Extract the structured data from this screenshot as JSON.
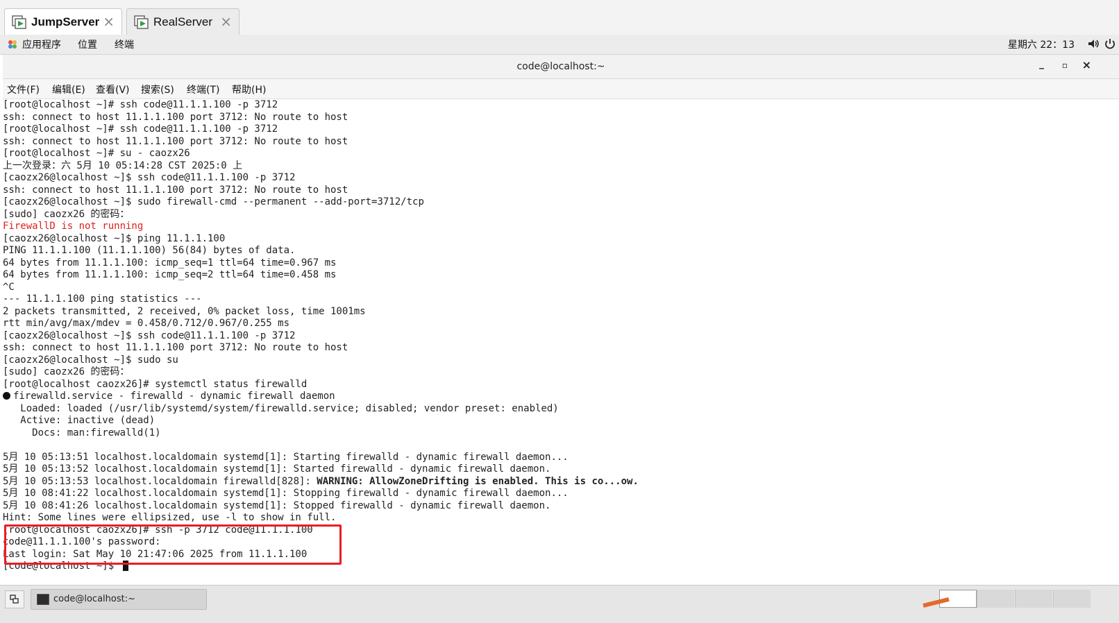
{
  "vm_tabs": [
    {
      "label": "JumpServer",
      "active": true,
      "icon": "vm-play-icon"
    },
    {
      "label": "RealServer",
      "active": false,
      "icon": "vm-play-icon"
    }
  ],
  "topbar": {
    "applications": "应用程序",
    "places": "位置",
    "terminal": "终端",
    "clock": "星期六 22：13",
    "volume_icon": "volume-icon",
    "power_icon": "power-icon"
  },
  "window": {
    "title": "code@localhost:~",
    "minimize": "_",
    "maximize": "▫",
    "close": "×"
  },
  "menubar": [
    "文件(F)",
    "编辑(E)",
    "查看(V)",
    "搜索(S)",
    "终端(T)",
    "帮助(H)"
  ],
  "terminal_lines": [
    "[root@localhost ~]# ssh code@11.1.1.100 -p 3712",
    "ssh: connect to host 11.1.1.100 port 3712: No route to host",
    "[root@localhost ~]# ssh code@11.1.1.100 -p 3712",
    "ssh: connect to host 11.1.1.100 port 3712: No route to host",
    "[root@localhost ~]# su - caozx26",
    "上一次登录：六 5月 10 05:14:28 CST 2025:0 上",
    "[caozx26@localhost ~]$ ssh code@11.1.1.100 -p 3712",
    "ssh: connect to host 11.1.1.100 port 3712: No route to host",
    "[caozx26@localhost ~]$ sudo firewall-cmd --permanent --add-port=3712/tcp",
    "[sudo] caozx26 的密码：",
    "FirewallD is not running",
    "[caozx26@localhost ~]$ ping 11.1.1.100",
    "PING 11.1.1.100 (11.1.1.100) 56(84) bytes of data.",
    "64 bytes from 11.1.1.100: icmp_seq=1 ttl=64 time=0.967 ms",
    "64 bytes from 11.1.1.100: icmp_seq=2 ttl=64 time=0.458 ms",
    "^C",
    "--- 11.1.1.100 ping statistics ---",
    "2 packets transmitted, 2 received, 0% packet loss, time 1001ms",
    "rtt min/avg/max/mdev = 0.458/0.712/0.967/0.255 ms",
    "[caozx26@localhost ~]$ ssh code@11.1.1.100 -p 3712",
    "ssh: connect to host 11.1.1.100 port 3712: No route to host",
    "[caozx26@localhost ~]$ sudo su",
    "[sudo] caozx26 的密码：",
    "[root@localhost caozx26]# systemctl status firewalld",
    "firewalld.service - firewalld - dynamic firewall daemon",
    "   Loaded: loaded (/usr/lib/systemd/system/firewalld.service; disabled; vendor preset: enabled)",
    "   Active: inactive (dead)",
    "     Docs: man:firewalld(1)",
    "",
    "5月 10 05:13:51 localhost.localdomain systemd[1]: Starting firewalld - dynamic firewall daemon...",
    "5月 10 05:13:52 localhost.localdomain systemd[1]: Started firewalld - dynamic firewall daemon.",
    "5月 10 05:13:53 localhost.localdomain firewalld[828]: ",
    "5月 10 08:41:22 localhost.localdomain systemd[1]: Stopping firewalld - dynamic firewall daemon...",
    "5月 10 08:41:26 localhost.localdomain systemd[1]: Stopped firewalld - dynamic firewall daemon.",
    "Hint: Some lines were ellipsized, use -l to show in full.",
    "[root@localhost caozx26]# ssh -p 3712 code@11.1.1.100",
    "code@11.1.1.100's password:",
    "Last login: Sat May 10 21:47:06 2025 from 11.1.1.100",
    "[code@localhost ~]$ "
  ],
  "warning_text": "WARNING: AllowZoneDrifting is enabled. This is co...ow.",
  "taskbar": {
    "task_label": "code@localhost:~",
    "show_desktop_icon": "show-desktop-icon",
    "terminal_icon": "terminal-icon"
  },
  "colors": {
    "error_red": "#e0201c",
    "highlight_red": "#ea1c24",
    "vm_icon_green": "#2ea043"
  }
}
